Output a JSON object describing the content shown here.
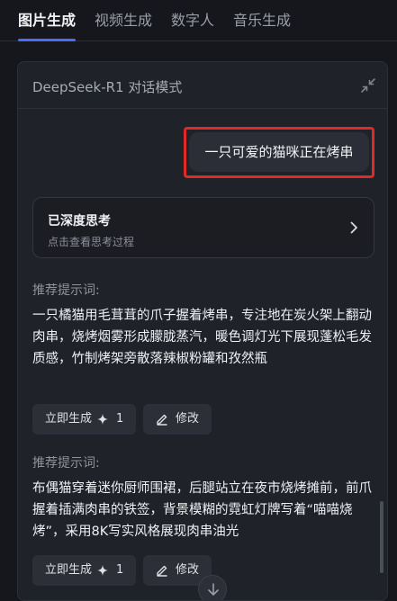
{
  "tabs": [
    {
      "label": "图片生成",
      "active": true
    },
    {
      "label": "视频生成",
      "active": false
    },
    {
      "label": "数字人",
      "active": false
    },
    {
      "label": "音乐生成",
      "active": false
    }
  ],
  "panel": {
    "title": "DeepSeek-R1 对话模式",
    "user_message": "一只可爱的猫咪正在烤串",
    "think_card": {
      "title": "已深度思考",
      "subtitle": "点击查看思考过程"
    },
    "results": [
      {
        "label": "推荐提示词:",
        "text": "一只橘猫用毛茸茸的爪子握着烤串，专注地在炭火架上翻动肉串，烧烤烟雾形成朦胧蒸汽，暖色调灯光下展现蓬松毛发质感，竹制烤架旁散落辣椒粉罐和孜然瓶",
        "generate_label": "立即生成",
        "cost": "1",
        "edit_label": "修改"
      },
      {
        "label": "推荐提示词:",
        "text": "布偶猫穿着迷你厨师围裙，后腿站立在夜市烧烤摊前，前爪握着插满肉串的铁签，背景模糊的霓虹灯牌写着“喵喵烧烤”，采用8K写实风格展现肉串油光",
        "generate_label": "立即生成",
        "cost": "1",
        "edit_label": "修改"
      }
    ]
  },
  "colors": {
    "accent": "#4a6cf7",
    "highlight": "#e02a2a",
    "background": "#15171c",
    "panel": "#1f2229"
  },
  "icons": {
    "collapse": "collapse-arrows-icon",
    "chevron": "chevron-right-icon",
    "spark": "sparkle-icon",
    "edit": "pencil-icon",
    "scroll": "chevron-down-icon"
  }
}
